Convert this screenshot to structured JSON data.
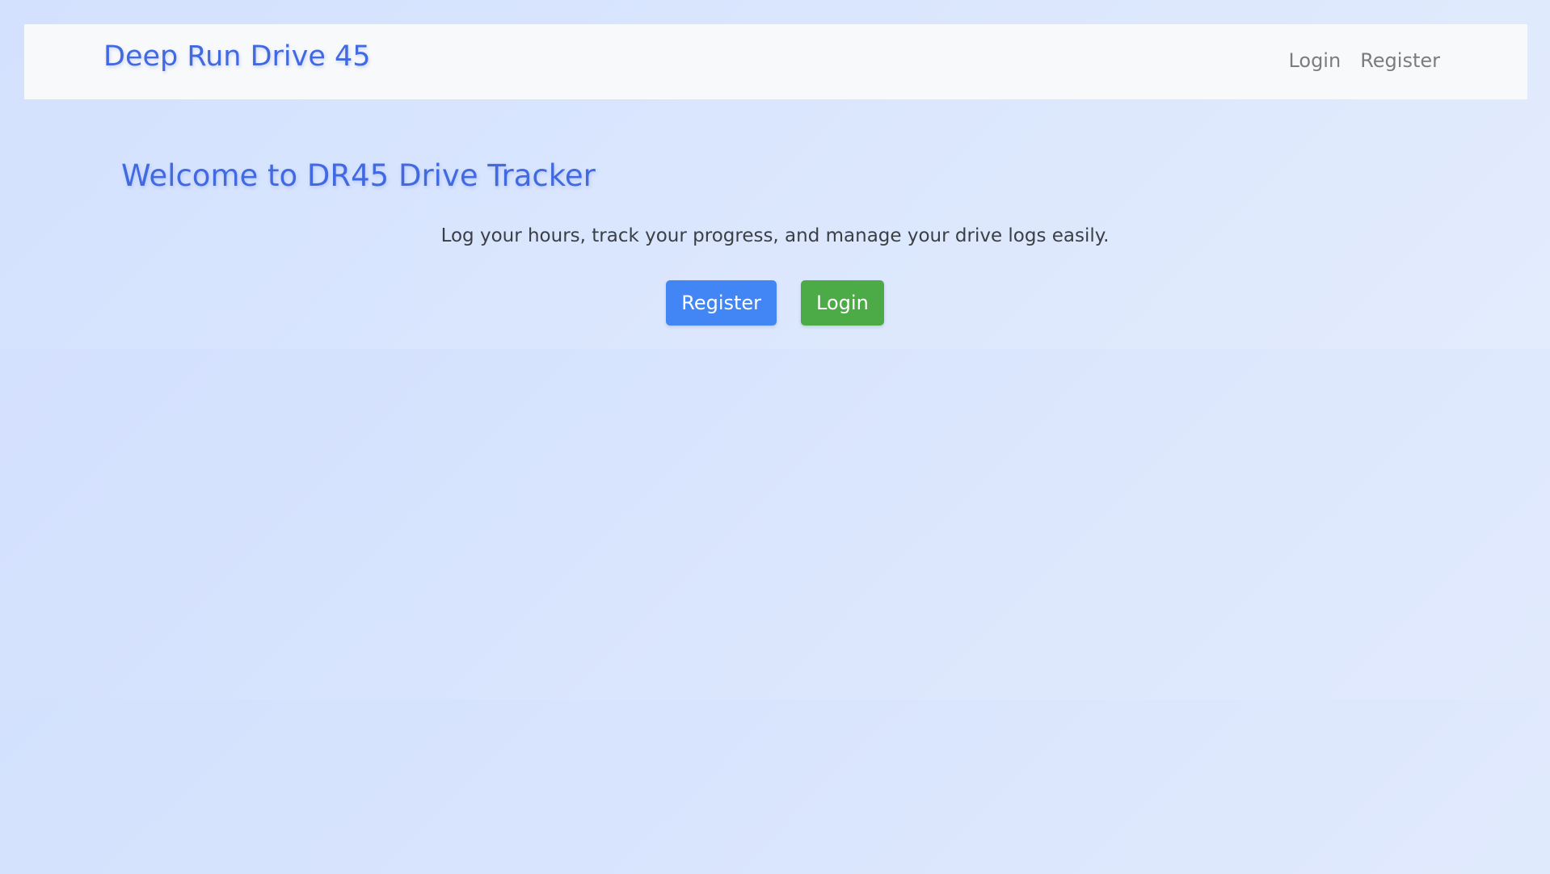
{
  "navbar": {
    "brand": "Deep Run Drive 45",
    "links": [
      {
        "label": "Login"
      },
      {
        "label": "Register"
      }
    ]
  },
  "main": {
    "heading": "Welcome to DR45 Drive Tracker",
    "tagline": "Log your hours, track your progress, and manage your drive logs easily.",
    "buttons": {
      "register_label": "Register",
      "login_label": "Login"
    }
  },
  "colors": {
    "brand": "#4169e1",
    "register_button": "#4285f4",
    "login_button": "#4caa47",
    "navbar_bg": "#f8f9fa",
    "page_bg": "#d9e5fd"
  }
}
